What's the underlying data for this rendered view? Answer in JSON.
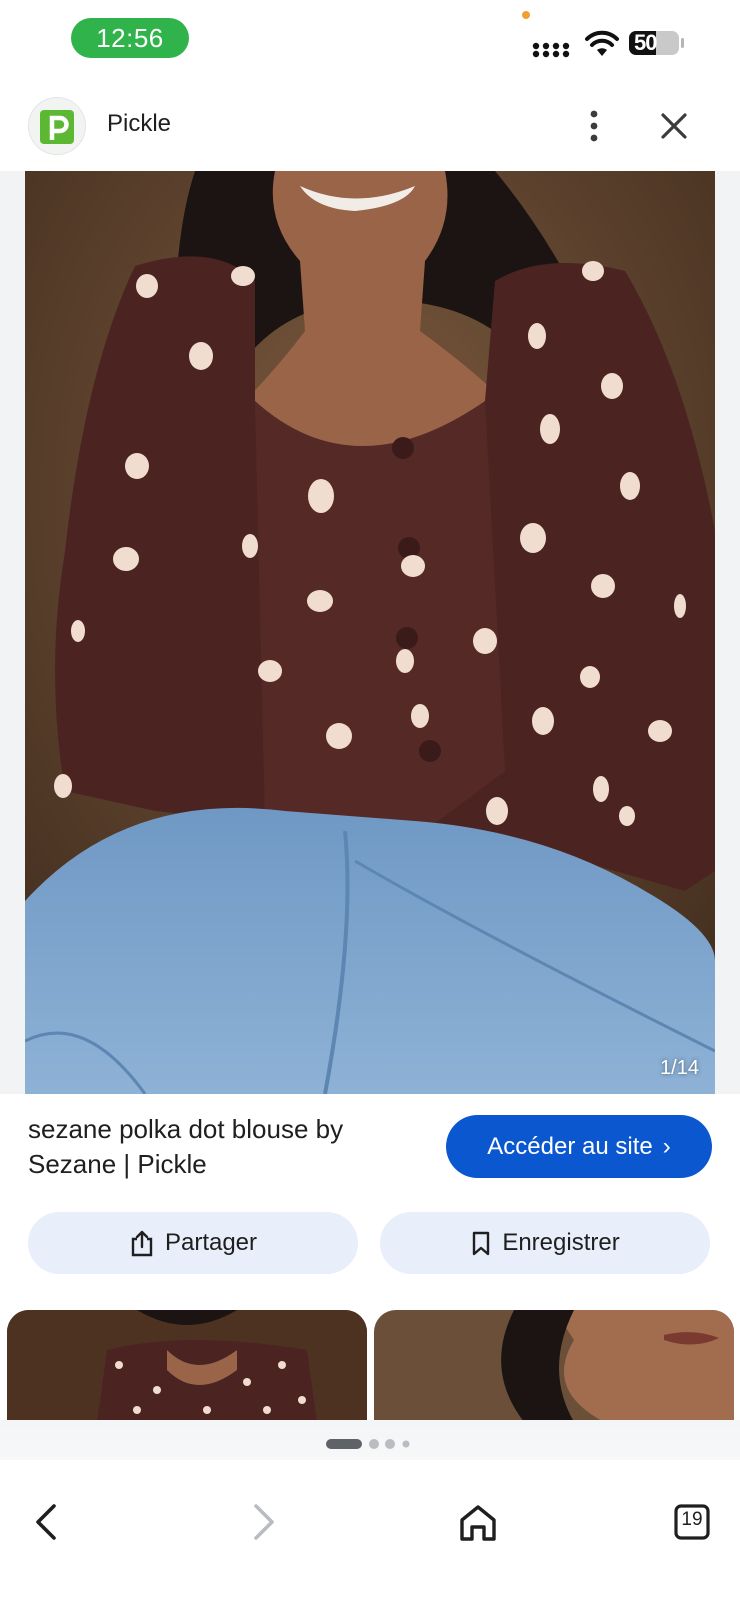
{
  "status_bar": {
    "time": "12:56",
    "battery": "50",
    "colors": {
      "time_pill": "#2fb34a"
    }
  },
  "header": {
    "site_name": "Pickle",
    "icons": {
      "logo": "pickle-logo-icon",
      "more": "more-vert-icon",
      "close": "close-icon"
    }
  },
  "image_viewer": {
    "counter": "1/14"
  },
  "result": {
    "title": "sezane polka dot blouse by Sezane | Pickle",
    "visit_label": "Accéder au site",
    "colors": {
      "visit_button": "#0b57d0"
    }
  },
  "actions": {
    "share_label": "Partager",
    "save_label": "Enregistrer",
    "icons": {
      "share": "share-icon",
      "save": "bookmark-icon"
    }
  },
  "bottom_nav": {
    "tabs_count": "19",
    "icons": {
      "back": "back-arrow-icon",
      "forward": "forward-arrow-icon",
      "home": "home-icon",
      "tabs": "tabs-icon"
    }
  }
}
